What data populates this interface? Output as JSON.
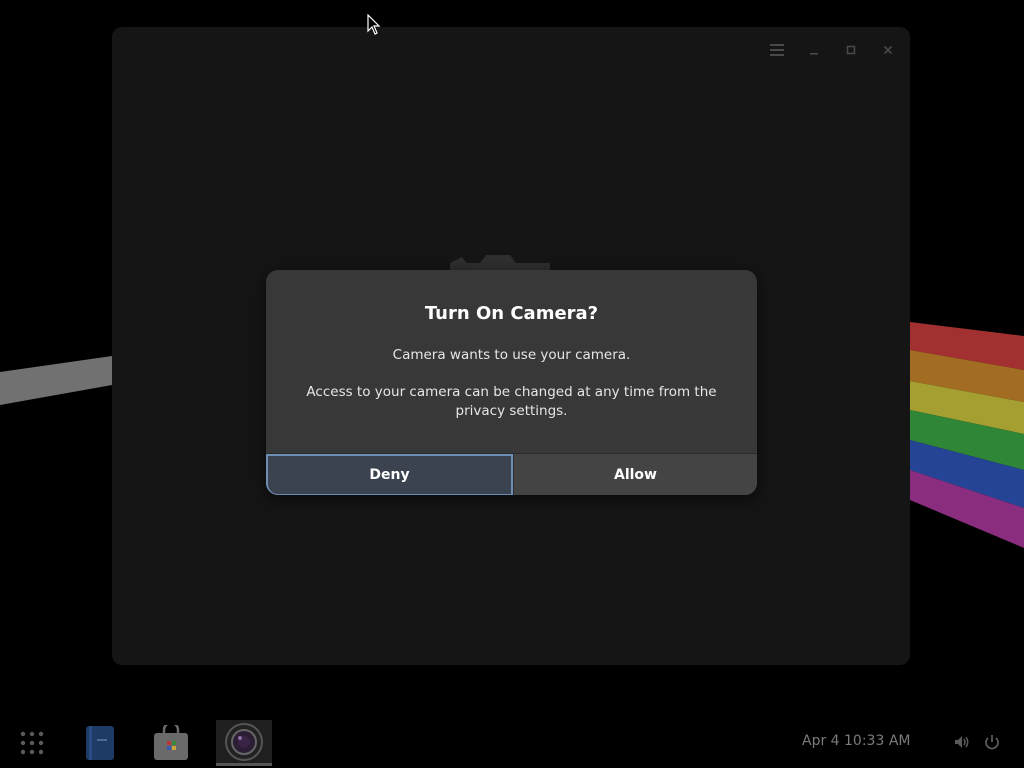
{
  "dialog": {
    "title": "Turn On Camera?",
    "message": "Camera wants to use your camera.",
    "detail": "Access to your camera can be changed at any time from the privacy settings.",
    "deny_label": "Deny",
    "allow_label": "Allow"
  },
  "window": {
    "controls": [
      {
        "icon": "hamburger-menu-icon"
      },
      {
        "icon": "minimize-icon"
      },
      {
        "icon": "maximize-icon"
      },
      {
        "icon": "close-icon"
      }
    ]
  },
  "taskbar": {
    "apps": [
      {
        "icon": "app-grid-icon"
      },
      {
        "icon": "notes-app-icon"
      },
      {
        "icon": "software-store-icon"
      },
      {
        "icon": "camera-app-icon",
        "active": true
      }
    ],
    "clock": "Apr 4  10:33 AM",
    "tray": [
      {
        "icon": "volume-icon"
      },
      {
        "icon": "power-icon"
      }
    ]
  },
  "colors": {
    "dialog_bg": "#383838",
    "deny_focus_border": "#6d8fb6",
    "window_bg": "#1a1a1a"
  }
}
